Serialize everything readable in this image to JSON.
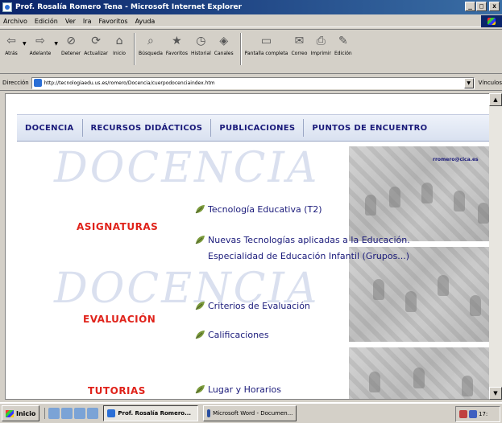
{
  "window": {
    "title": "Prof. Rosalía Romero Tena - Microsoft Internet Explorer",
    "controls": [
      "_",
      "□",
      "x"
    ]
  },
  "menu": [
    "Archivo",
    "Edición",
    "Ver",
    "Ira",
    "Favoritos",
    "Ayuda"
  ],
  "toolbar": [
    {
      "label": "Atrás",
      "icon": "back-arrow-icon",
      "glyph": "⇦"
    },
    {
      "label": "Adelante",
      "icon": "forward-arrow-icon",
      "glyph": "⇨"
    },
    {
      "label": "Detener",
      "icon": "stop-icon",
      "glyph": "⊘"
    },
    {
      "label": "Actualizar",
      "icon": "refresh-icon",
      "glyph": "⟳"
    },
    {
      "label": "Inicio",
      "icon": "home-icon",
      "glyph": "⌂"
    },
    {
      "label": "Búsqueda",
      "icon": "search-icon",
      "glyph": "⌕"
    },
    {
      "label": "Favoritos",
      "icon": "favorites-icon",
      "glyph": "★"
    },
    {
      "label": "Historial",
      "icon": "history-icon",
      "glyph": "◷"
    },
    {
      "label": "Canales",
      "icon": "channels-icon",
      "glyph": "◈"
    },
    {
      "label": "Pantalla completa",
      "icon": "fullscreen-icon",
      "glyph": "▭"
    },
    {
      "label": "Correo",
      "icon": "mail-icon",
      "glyph": "✉"
    },
    {
      "label": "Imprimir",
      "icon": "print-icon",
      "glyph": "⎙"
    },
    {
      "label": "Edición",
      "icon": "edit-icon",
      "glyph": "✎"
    }
  ],
  "address": {
    "label": "Dirección",
    "value": "http://tecnologiaedu.us.es/romero/Docencia/cuerpodocenciaindex.htm",
    "go_label": "Vínculos"
  },
  "page": {
    "nav": [
      "DOCENCIA",
      "RECURSOS DIDÁCTICOS",
      "PUBLICACIONES",
      "PUNTOS DE ENCUENTRO"
    ],
    "watermark": "DOCENCIA",
    "email": "rromero@cica.es",
    "sections": [
      {
        "title": "ASIGNATURAS",
        "links": [
          "Tecnología Educativa (T2)",
          "Nuevas Tecnologías aplicadas a la Educación. Especialidad de Educación Infantil (Grupos...)"
        ]
      },
      {
        "title": "EVALUACIÓN",
        "links": [
          "Criterios de Evaluación",
          "Calificaciones"
        ]
      },
      {
        "title": "TUTORIAS",
        "links": [
          "Lugar y Horarios"
        ]
      }
    ]
  },
  "taskbar": {
    "start": "Inicio",
    "tasks": [
      {
        "label": "Prof. Rosalía Romero...",
        "active": true
      },
      {
        "label": "Microsoft Word - Documen...",
        "active": false
      }
    ],
    "clock": "17:"
  },
  "colors": {
    "title_bar": "#0a246a",
    "nav_text": "#1a1a7a",
    "section_red": "#e0231b",
    "link_blue": "#1a1a7a"
  }
}
